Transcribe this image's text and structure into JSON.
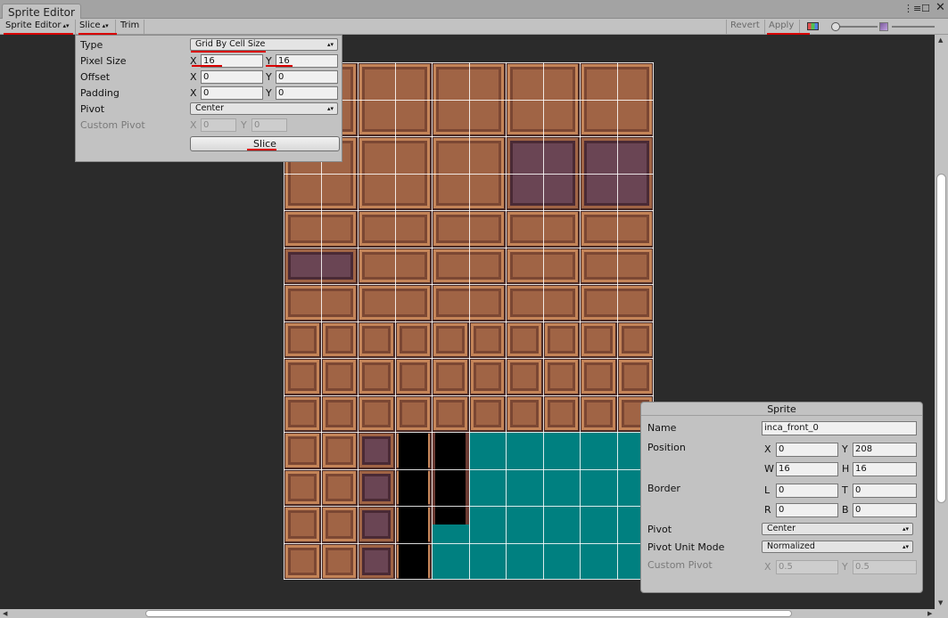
{
  "window": {
    "tab_title": "Sprite Editor",
    "menu_icon": "list-menu-icon",
    "maximize_icon": "maximize-icon",
    "close_icon": "close-icon"
  },
  "toolbar": {
    "sprite_editor_label": "Sprite Editor",
    "slice_label": "Slice",
    "trim_label": "Trim",
    "revert_label": "Revert",
    "apply_label": "Apply",
    "dropdown_arrows": "▴▾"
  },
  "slice_panel": {
    "type_label": "Type",
    "type_value": "Grid By Cell Size",
    "pixel_size_label": "Pixel Size",
    "pixel_size_x": "16",
    "pixel_size_y": "16",
    "offset_label": "Offset",
    "offset_x": "0",
    "offset_y": "0",
    "padding_label": "Padding",
    "padding_x": "0",
    "padding_y": "0",
    "pivot_label": "Pivot",
    "pivot_value": "Center",
    "custom_pivot_label": "Custom Pivot",
    "custom_pivot_x": "0",
    "custom_pivot_y": "0",
    "slice_button": "Slice",
    "axis_x": "X",
    "axis_y": "Y"
  },
  "sprite_panel": {
    "header": "Sprite",
    "name_label": "Name",
    "name_value": "inca_front_0",
    "position_label": "Position",
    "pos_x": "0",
    "pos_y": "208",
    "pos_w": "16",
    "pos_h": "16",
    "border_label": "Border",
    "border_l": "0",
    "border_t": "0",
    "border_r": "0",
    "border_b": "0",
    "pivot_label": "Pivot",
    "pivot_value": "Center",
    "pivot_unit_label": "Pivot Unit Mode",
    "pivot_unit_value": "Normalized",
    "custom_pivot_label": "Custom Pivot",
    "custom_pivot_x": "0.5",
    "custom_pivot_y": "0.5",
    "axes": {
      "x": "X",
      "y": "Y",
      "w": "W",
      "h": "H",
      "l": "L",
      "t": "T",
      "r": "R",
      "b": "B"
    }
  },
  "colors": {
    "accent_underline": "#d80000",
    "sheet_teal": "#008080",
    "sheet_brick": "#a06445"
  }
}
